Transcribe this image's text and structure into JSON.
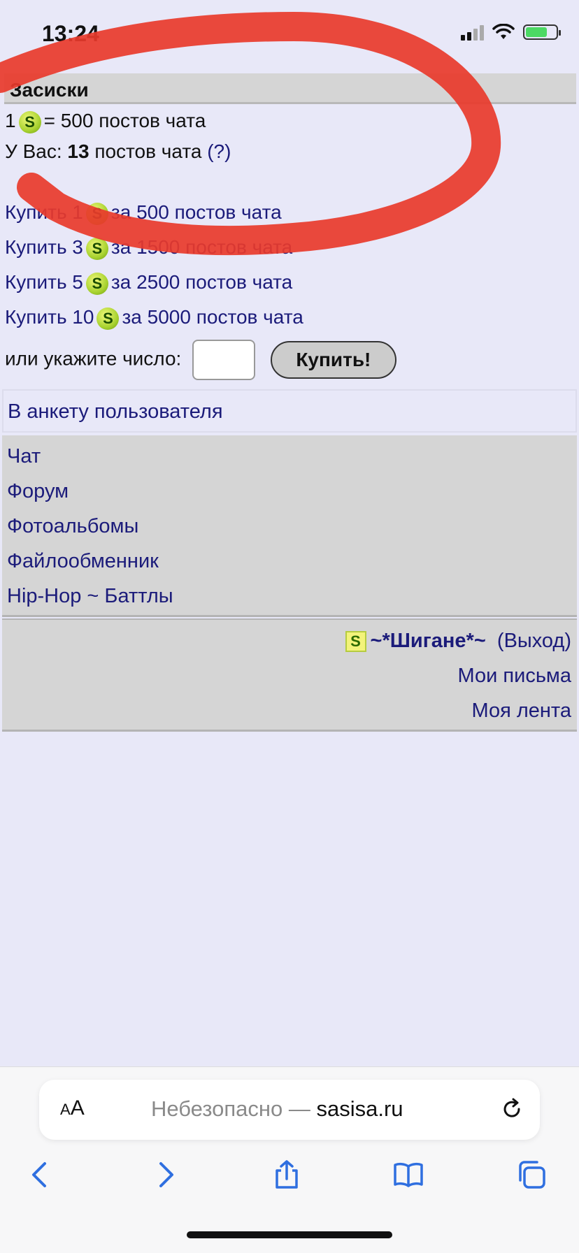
{
  "status_bar": {
    "time": "13:24"
  },
  "header": {
    "title": "Засиски"
  },
  "rate": {
    "prefix": "1",
    "suffix": "= 500 постов чата",
    "coin_glyph": "S"
  },
  "balance": {
    "prefix": "У Вас:",
    "count": "13",
    "suffix": "постов чата",
    "help_link": "(?)"
  },
  "offers": [
    {
      "buy_label": "Купить 1",
      "price_label": "за 500 постов чата"
    },
    {
      "buy_label": "Купить 3",
      "price_label": "за 1500 постов чата"
    },
    {
      "buy_label": "Купить 5",
      "price_label": "за 2500 постов чата"
    },
    {
      "buy_label": "Купить 10",
      "price_label": "за 5000 постов чата"
    }
  ],
  "custom": {
    "label": "или укажите число:",
    "input_value": "",
    "button_label": "Купить!"
  },
  "profile_link": "В анкету пользователя",
  "nav": [
    "Чат",
    "Форум",
    "Фотоальбомы",
    "Файлообменник",
    "Hip-Hop ~ Баттлы"
  ],
  "user": {
    "badge": "S",
    "name": "~*Шигане*~",
    "logout": "(Выход)",
    "messages": "Мои письма",
    "feed": "Моя лента"
  },
  "browser": {
    "aa_small": "A",
    "aa_large": "A",
    "security_label": "Небезопасно —",
    "domain": "sasisa.ru"
  },
  "colors": {
    "background": "#e8e8f8",
    "link": "#1b1b7a",
    "panel": "#d5d5d5",
    "scribble": "#e8392b"
  }
}
